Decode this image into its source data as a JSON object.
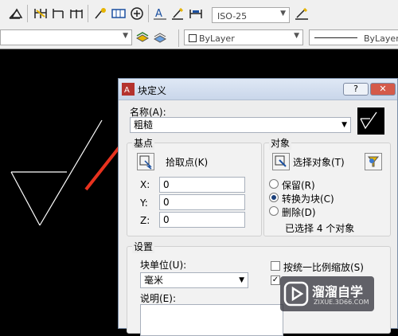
{
  "toolbar": {
    "dimstyle_value": "ISO-25",
    "layer_value": "",
    "color_value": "ByLayer",
    "linetype_value": "ByLayer"
  },
  "dialog": {
    "title": "块定义",
    "help_label": "?",
    "close_label": "✕",
    "name_label": "名称(A):",
    "name_value": "粗糙",
    "basepoint": {
      "group_label": "基点",
      "pick_label": "拾取点(K)",
      "x_label": "X:",
      "x_value": "0",
      "y_label": "Y:",
      "y_value": "0",
      "z_label": "Z:",
      "z_value": "0"
    },
    "objects": {
      "group_label": "对象",
      "select_label": "选择对象(T)",
      "retain_label": "保留(R)",
      "convert_label": "转换为块(C)",
      "delete_label": "删除(D)",
      "status": "已选择 4 个对象"
    },
    "settings": {
      "group_label": "设置",
      "unit_label": "块单位(U):",
      "unit_value": "毫米",
      "uniform_scale_label": "按统一比例缩放(S)",
      "desc_label": "说明(E):"
    }
  },
  "watermark": {
    "brand": "溜溜自学",
    "url": "ZIXUE.3D66.COM"
  },
  "colors": {
    "canvas": "#000000",
    "arrow": "#e8321e",
    "dialog_bg": "#ededed"
  }
}
